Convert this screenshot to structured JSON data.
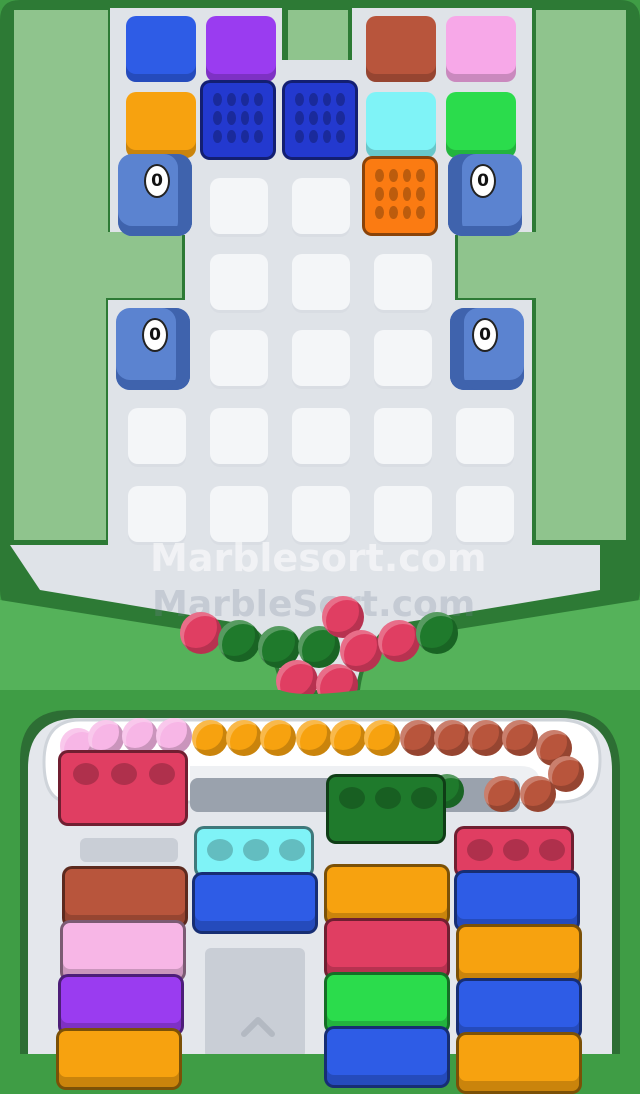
{
  "watermark": {
    "main": "Marblesort.com",
    "secondary": "MarbleSort.com"
  },
  "launchers": [
    {
      "name": "launcher-top-left",
      "count": "0"
    },
    {
      "name": "launcher-top-right",
      "count": "0"
    },
    {
      "name": "launcher-mid-left",
      "count": "0"
    },
    {
      "name": "launcher-mid-right",
      "count": "0"
    }
  ],
  "colors": {
    "blue": "#2e5ce6",
    "purple": "#9a3cf0",
    "brown": "#b8553c",
    "pink": "#f7a8e8",
    "orange": "#f7a20f",
    "cyan": "#7ff3f7",
    "green": "#2bdc4c",
    "red": "#e03e62",
    "darkgreen": "#1f7a2c",
    "lightpink": "#f7b6e6"
  }
}
